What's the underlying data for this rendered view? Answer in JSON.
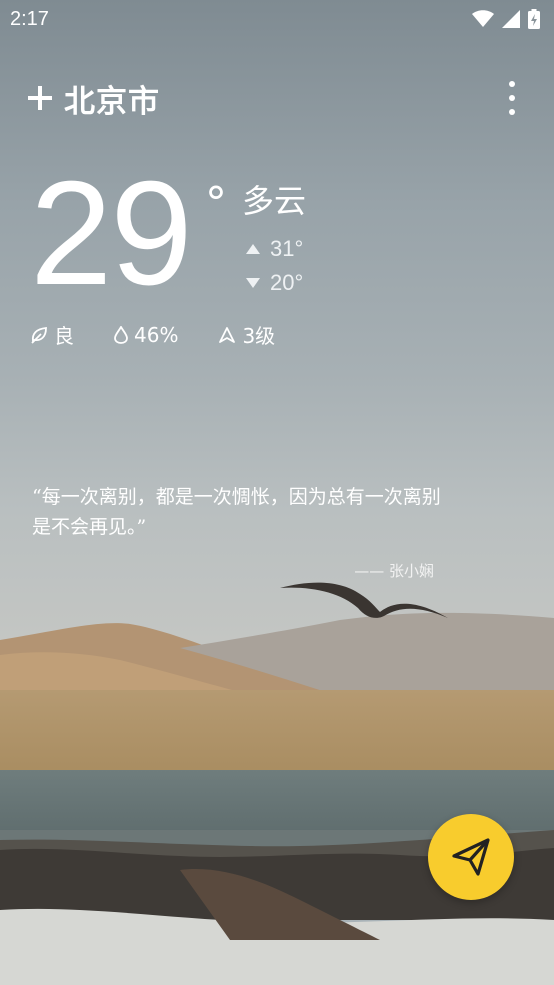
{
  "status_bar": {
    "time": "2:17",
    "icons": [
      "wifi-icon",
      "signal-icon",
      "battery-charging-icon"
    ]
  },
  "header": {
    "add_icon": "plus-icon",
    "city": "北京市",
    "menu_icon": "more-vertical-icon"
  },
  "weather": {
    "temperature": "29",
    "degree_symbol": "°",
    "condition": "多云",
    "high": "31°",
    "low": "20°",
    "air_quality": "良",
    "humidity": "46%",
    "wind": "3级"
  },
  "quote": {
    "text": "“每一次离别，都是一次惆怅，因为总有一次离别是不会再见。”",
    "author": "—— 张小娴"
  },
  "fab": {
    "icon": "send-icon",
    "color": "#f8cc2d"
  }
}
